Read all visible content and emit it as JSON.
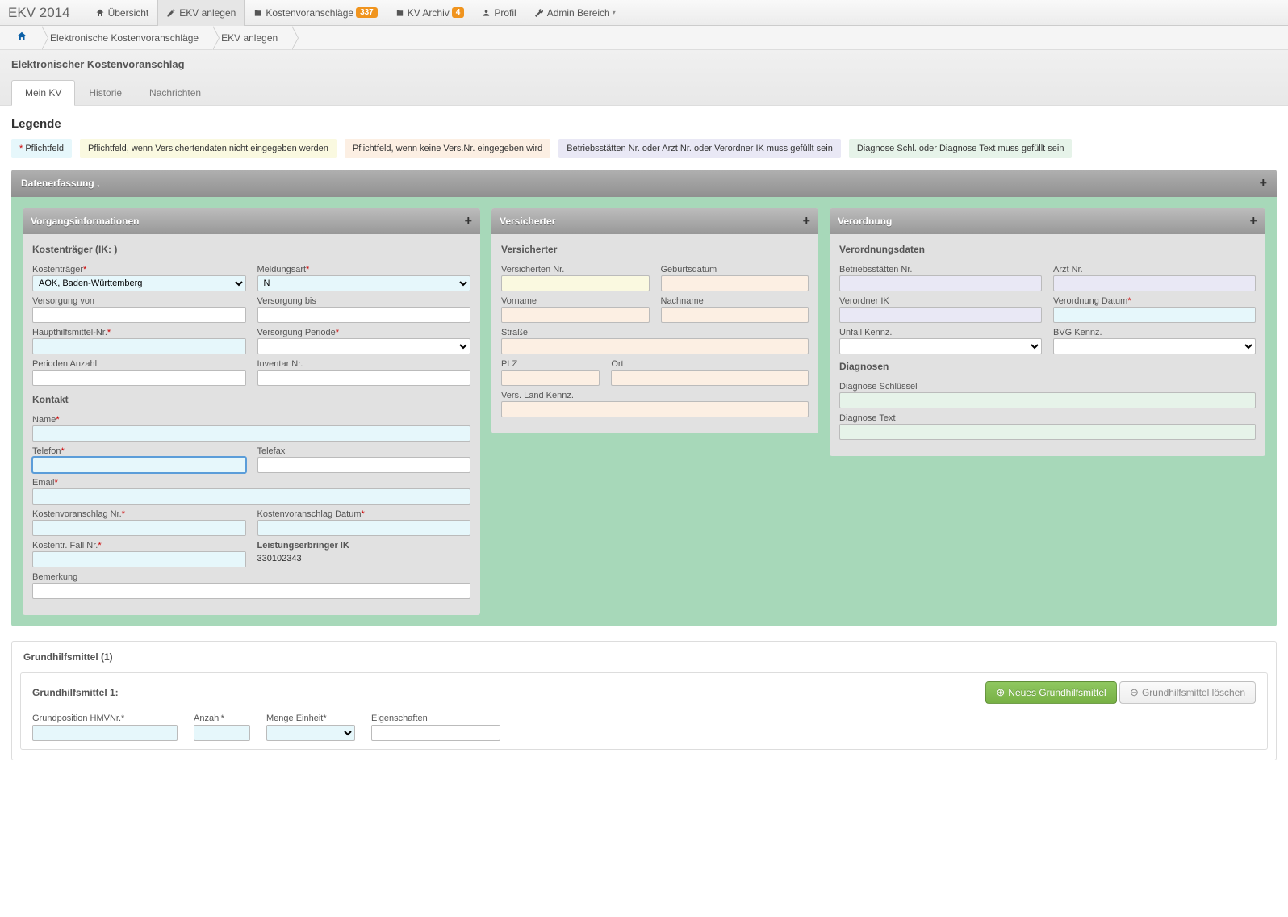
{
  "brand": "EKV 2014",
  "nav": {
    "overview": "Übersicht",
    "create": "EKV anlegen",
    "kv_label": "Kostenvoranschläge",
    "kv_badge": "337",
    "archive_label": "KV Archiv",
    "archive_badge": "4",
    "profile": "Profil",
    "admin": "Admin Bereich"
  },
  "breadcrumb": {
    "level1": "Elektronische Kostenvoranschläge",
    "level2": "EKV anlegen"
  },
  "page_title": "Elektronischer Kostenvoranschlag",
  "tabs": {
    "mein_kv": "Mein KV",
    "historie": "Historie",
    "nachrichten": "Nachrichten"
  },
  "legend": {
    "title": "Legende",
    "required": "Pflichtfeld",
    "yellow": "Pflichtfeld, wenn Versichertendaten nicht eingegeben werden",
    "orange": "Pflichtfeld, wenn keine Vers.Nr. eingegeben wird",
    "purple": "Betriebsstätten Nr. oder Arzt Nr. oder Verordner IK muss gefüllt sein",
    "green": "Diagnose Schl. oder Diagnose Text muss gefüllt sein"
  },
  "section_data": "Datenerfassung ,",
  "panel1": {
    "title": "Vorgangsinformationen",
    "group_kostentraeger": "Kostenträger (IK:  )",
    "kostentraeger_label": "Kostenträger",
    "kostentraeger_value": "AOK, Baden-Württemberg",
    "meldungsart_label": "Meldungsart",
    "meldungsart_value": "N",
    "versorgung_von": "Versorgung von",
    "versorgung_bis": "Versorgung bis",
    "haupthm_label": "Haupthilfsmittel-Nr.",
    "versorgung_periode": "Versorgung Periode",
    "perioden_anzahl": "Perioden Anzahl",
    "inventar_nr": "Inventar Nr.",
    "group_kontakt": "Kontakt",
    "name": "Name",
    "telefon": "Telefon",
    "telefax": "Telefax",
    "email": "Email",
    "kv_nr": "Kostenvoranschlag Nr.",
    "kv_datum": "Kostenvoranschlag Datum",
    "fall_nr": "Kostentr. Fall Nr.",
    "leistungserbringer": "Leistungserbringer IK",
    "leistungserbringer_value": "330102343",
    "bemerkung": "Bemerkung"
  },
  "panel2": {
    "title": "Versicherter",
    "group": "Versicherter",
    "versicherten_nr": "Versicherten Nr.",
    "geburtsdatum": "Geburtsdatum",
    "vorname": "Vorname",
    "nachname": "Nachname",
    "strasse": "Straße",
    "plz": "PLZ",
    "ort": "Ort",
    "land": "Vers. Land Kennz."
  },
  "panel3": {
    "title": "Verordnung",
    "group_daten": "Verordnungsdaten",
    "betriebsstaetten": "Betriebsstätten Nr.",
    "arzt_nr": "Arzt Nr.",
    "verordner_ik": "Verordner IK",
    "verordnung_datum": "Verordnung Datum",
    "unfall": "Unfall Kennz.",
    "bvg": "BVG Kennz.",
    "group_diag": "Diagnosen",
    "diag_schl": "Diagnose Schlüssel",
    "diag_text": "Diagnose Text"
  },
  "ghm": {
    "outer_title": "Grundhilfsmittel (1)",
    "inner_title": "Grundhilfsmittel 1:",
    "btn_new": "Neues Grundhilfsmittel",
    "btn_delete": "Grundhilfsmittel löschen",
    "grundposition": "Grundposition HMVNr.",
    "anzahl": "Anzahl",
    "menge": "Menge Einheit",
    "eigenschaften": "Eigenschaften"
  }
}
